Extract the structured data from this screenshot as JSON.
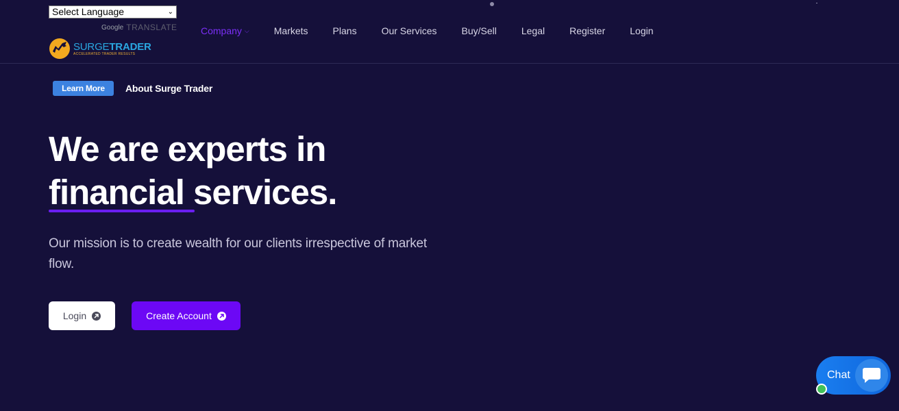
{
  "header": {
    "language_select": "Select Language",
    "powered_by_google": "Google",
    "powered_by_translate": "TRANSLATE",
    "logo": {
      "name_part1": "SURGE",
      "name_part2": "TRADER",
      "tagline": "ACCELERATED TRADER RESULTS"
    },
    "nav": [
      {
        "label": "Company",
        "active": true,
        "has_dropdown": true
      },
      {
        "label": "Markets"
      },
      {
        "label": "Plans"
      },
      {
        "label": "Our Services"
      },
      {
        "label": "Buy/Sell"
      },
      {
        "label": "Legal"
      },
      {
        "label": "Register"
      },
      {
        "label": "Login"
      }
    ]
  },
  "hero": {
    "learn_more": "Learn More",
    "about": "About Surge Trader",
    "headline_line1": "We are experts in",
    "headline_word": "financial",
    "headline_rest": " services.",
    "mission": "Our mission is to create wealth for our clients irrespective of market flow.",
    "login_button": "Login",
    "create_account_button": "Create Account"
  },
  "chat": {
    "label": "Chat"
  },
  "colors": {
    "background": "#15103a",
    "accent_purple": "#6c08f5",
    "learn_blue": "#3c82e0",
    "chat_blue": "#1a7ef0",
    "online_green": "#41c15a"
  }
}
